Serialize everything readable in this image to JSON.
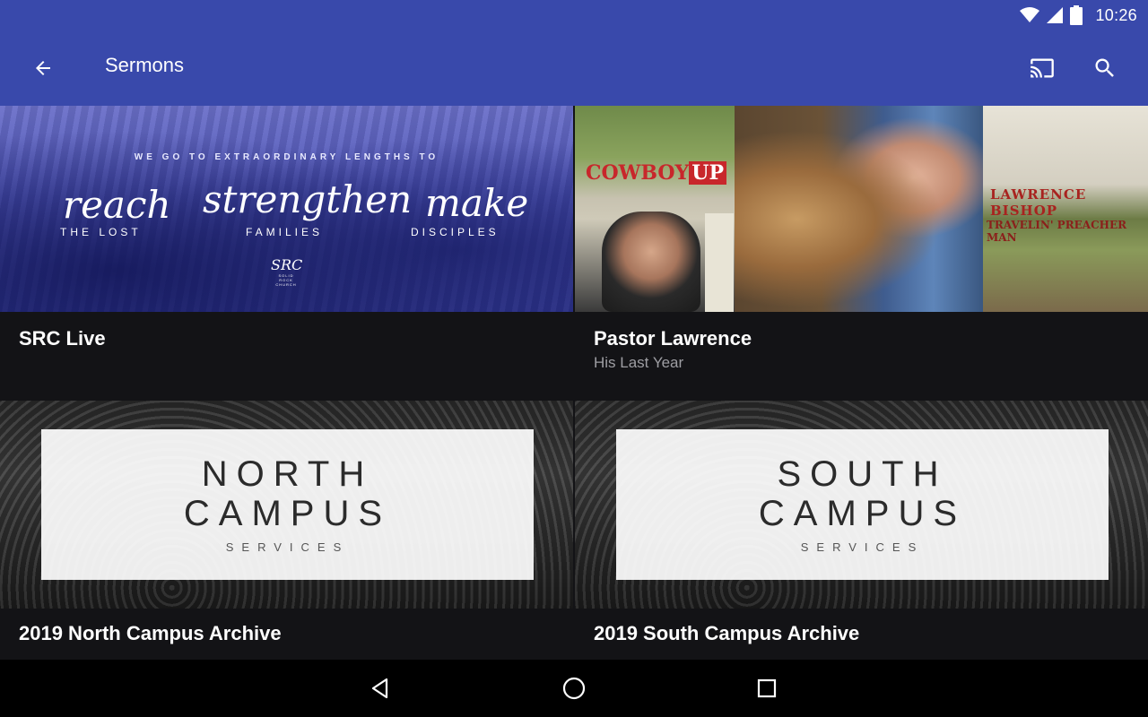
{
  "status": {
    "time": "10:26"
  },
  "appbar": {
    "title": "Sermons"
  },
  "icons": {
    "back": "arrow-back-icon",
    "cast": "cast-icon",
    "search": "search-icon"
  },
  "cards": [
    {
      "title": "SRC Live",
      "subtitle": "",
      "art": {
        "tagline": "WE GO TO EXTRAORDINARY LENGTHS TO",
        "w1": "reach",
        "s1": "THE LOST",
        "w2": "strengthen",
        "s2": "FAMILIES",
        "w3": "make",
        "s3": "DISCIPLES",
        "logo": "SRC",
        "logo_sub": "SOLID ROCK CHURCH"
      }
    },
    {
      "title": "Pastor Lawrence",
      "subtitle": "His Last Year",
      "art": {
        "book1": "COWBOY",
        "book1_b": "UP",
        "book2": "LAWRENCE BISHOP",
        "book3": "TRAVELIN' PREACHER MAN"
      }
    },
    {
      "title": "2019 North Campus Archive",
      "subtitle": "",
      "art": {
        "l1": "NORTH",
        "l2": "CAMPUS",
        "l3": "SERVICES"
      }
    },
    {
      "title": "2019 South Campus Archive",
      "subtitle": "",
      "art": {
        "l1": "SOUTH",
        "l2": "CAMPUS",
        "l3": "SERVICES"
      }
    }
  ],
  "colors": {
    "primary": "#3949ab",
    "background": "#131316",
    "subtitle": "#9e9ea3"
  }
}
